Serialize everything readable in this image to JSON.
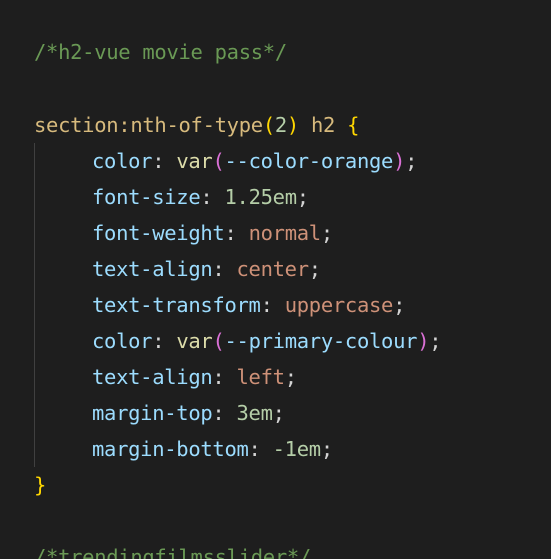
{
  "code": {
    "comment_top": "/*h2-vue movie pass*/",
    "selector": {
      "name": "section:nth-of-type",
      "open_paren": "(",
      "arg": "2",
      "close_paren": ")",
      "rest": " h2 ",
      "open_brace": "{"
    },
    "declarations": [
      {
        "prop": "color",
        "func": "var",
        "open": "(",
        "val": "--color-orange",
        "close": ")"
      },
      {
        "prop": "font-size",
        "val": "1.25em"
      },
      {
        "prop": "font-weight",
        "val": "normal"
      },
      {
        "prop": "text-align",
        "val": "center"
      },
      {
        "prop": "text-transform",
        "val": "uppercase"
      },
      {
        "prop": "color",
        "func": "var",
        "open": "(",
        "val": "--primary-colour",
        "close": ")"
      },
      {
        "prop": "text-align",
        "val": "left"
      },
      {
        "prop": "margin-top",
        "val": "3em"
      },
      {
        "prop": "margin-bottom",
        "val": "-1em"
      }
    ],
    "close_brace": "}",
    "comment_bottom": "/*trendingfilmsslider*/",
    "colon": ": ",
    "semicolon": ";"
  },
  "theme": {
    "background": "#1e1e1e",
    "comment": "#6a9955",
    "selector": "#d7ba7d",
    "bracket": "#ffd700",
    "paren": "#da70d6",
    "number": "#b5cea8",
    "property": "#9cdcfe",
    "function": "#dcdcaa",
    "string_value": "#ce9178"
  }
}
